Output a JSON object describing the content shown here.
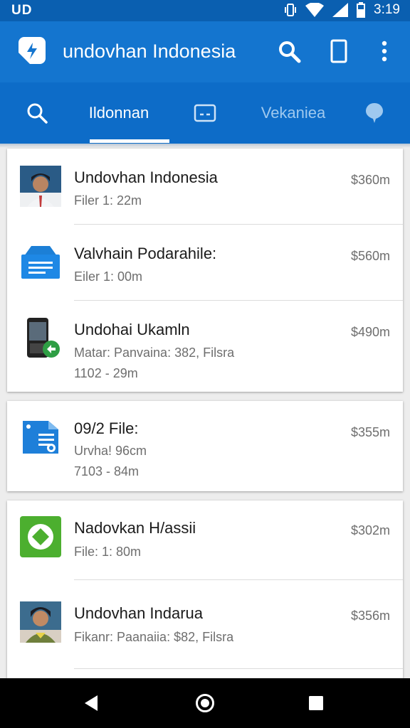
{
  "status_bar": {
    "left_text": "UD",
    "time": "3:19"
  },
  "app_bar": {
    "title": "undovhan Indonesia"
  },
  "tabs": [
    {
      "label": "Ildonnan",
      "icon": "search-icon"
    },
    {
      "label": "",
      "icon": "card-icon"
    },
    {
      "label": "Vekaniea",
      "icon": ""
    },
    {
      "label": "",
      "icon": "pin-icon"
    }
  ],
  "list": [
    {
      "title": "Undovhan Indonesia",
      "subtitle": "Filer 1: 22m",
      "subtitle2": "",
      "price": "$360m",
      "icon": "user-avatar-icon"
    },
    {
      "title": "Valvhain Podarahile:",
      "subtitle": "Eiler 1: 00m",
      "subtitle2": "",
      "price": "$560m",
      "icon": "file-list-icon"
    },
    {
      "title": "Undohai Ukamln",
      "subtitle": "Matar: Panvaina: 382, Filsra",
      "subtitle2": "1102 - 29m",
      "price": "$490m",
      "icon": "phone-share-icon"
    },
    {
      "title": "09/2 File:",
      "subtitle": "Urvha! 96cm",
      "subtitle2": "7103 - 84m",
      "price": "$355m",
      "icon": "document-edit-icon"
    },
    {
      "title": "Nadovkan H/assii",
      "subtitle": "File: 1: 80m",
      "subtitle2": "",
      "price": "$302m",
      "icon": "green-app-icon"
    },
    {
      "title": "Undovhan Indarua",
      "subtitle": "Fikanr: Paanaiia: $82, Filsra",
      "subtitle2": "",
      "price": "$356m",
      "icon": "user-avatar-icon"
    }
  ],
  "colors": {
    "primary": "#1475cf",
    "tab_bar": "#0d6cc8",
    "status_bar": "#0a5fb0",
    "nav_bar": "#000000"
  }
}
